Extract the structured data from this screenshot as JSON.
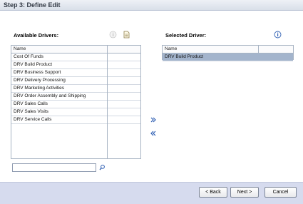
{
  "header": {
    "title": "Step 3: Define Edit"
  },
  "available": {
    "title": "Available Drivers:",
    "column_header": "Name",
    "items": [
      "Cost Of Funds",
      "DRV Build Product",
      "DRV Business Support",
      "DRV Delivery Processing",
      "DRV Marketing Activities",
      "DRV Order Assembly and Shipping",
      "DRV Sales Calls",
      "DRV Sales Visits",
      "DRV Service Calls"
    ],
    "search": {
      "value": "",
      "placeholder": ""
    }
  },
  "selected": {
    "title": "Selected Driver:",
    "column_header": "Name",
    "items": [
      "DRV Build Product"
    ]
  },
  "icons": {
    "info": "info-icon",
    "add_doc": "document-icon",
    "move_right": "double-chevron-right-icon",
    "move_left": "double-chevron-left-icon",
    "search": "search-icon"
  },
  "footer": {
    "back_label": "< Back",
    "next_label": "Next >",
    "cancel_label": "Cancel"
  },
  "colors": {
    "selected_row": "#a3b4cc",
    "footer_bg": "#d6dbee",
    "accent": "#2f5fb3"
  }
}
